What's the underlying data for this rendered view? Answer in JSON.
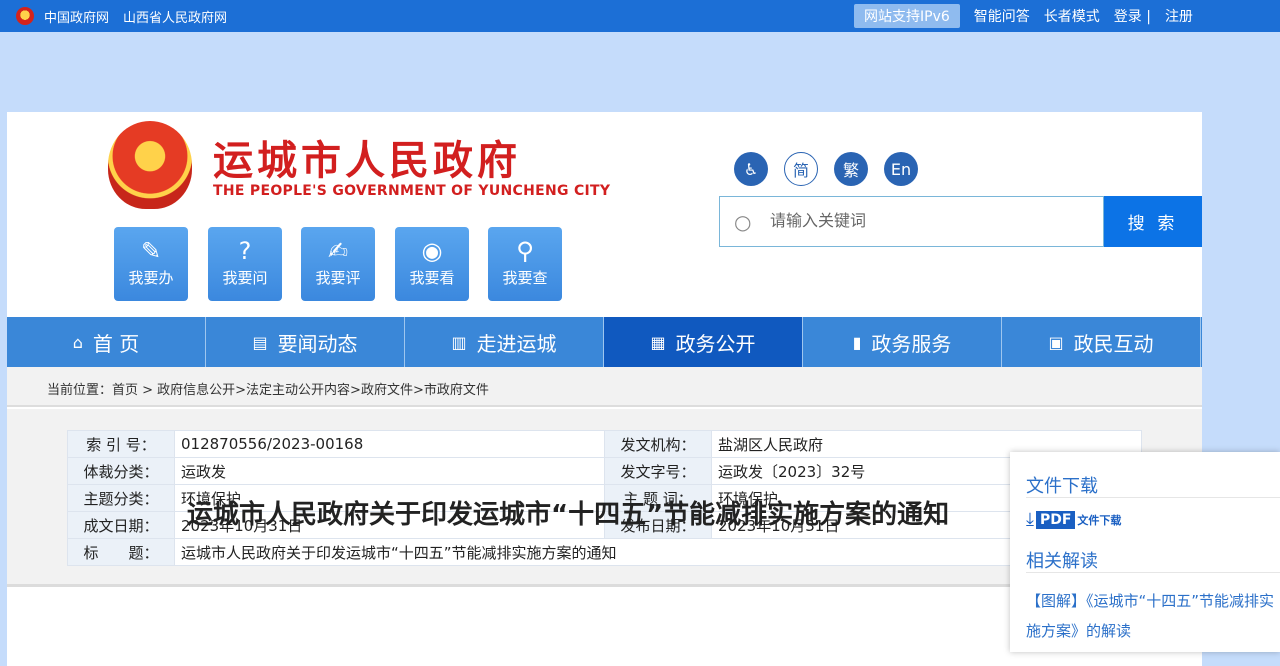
{
  "topbar": {
    "links": [
      "中国政府网",
      "山西省人民政府网"
    ],
    "ipv6": "网站支持IPv6",
    "right_links": [
      "智能问答",
      "长者模式",
      "登录 |",
      "注册"
    ]
  },
  "header": {
    "title": "运城市人民政府",
    "subtitle": "THE PEOPLE'S GOVERNMENT OF YUNCHENG  CITY",
    "quick_links": [
      {
        "label": "我要办",
        "icon": "form-icon"
      },
      {
        "label": "我要问",
        "icon": "question-icon"
      },
      {
        "label": "我要评",
        "icon": "edit-icon"
      },
      {
        "label": "我要看",
        "icon": "eye-icon"
      },
      {
        "label": "我要查",
        "icon": "search-icon"
      }
    ],
    "tools": [
      "accessibility",
      "简",
      "繁",
      "En"
    ],
    "search": {
      "placeholder": "请输入关键词",
      "button": "搜 索"
    }
  },
  "nav": [
    {
      "label": "首 页",
      "icon": "home-icon"
    },
    {
      "label": "要闻动态",
      "icon": "news-icon"
    },
    {
      "label": "走进运城",
      "icon": "building-icon"
    },
    {
      "label": "政务公开",
      "icon": "book-icon",
      "active": true
    },
    {
      "label": "政务服务",
      "icon": "bookmark-icon"
    },
    {
      "label": "政民互动",
      "icon": "chat-icon"
    }
  ],
  "breadcrumb": "当前位置：首页 > 政府信息公开>法定主动公开内容>政府文件>市政府文件",
  "meta": {
    "k1": "索 引 号：",
    "v1": "012870556/2023-00168",
    "k2": "发文机构：",
    "v2": "盐湖区人民政府",
    "k3": "体裁分类：",
    "v3": "运政发",
    "k4": "发文字号：",
    "v4": "运政发〔2023〕32号",
    "k5": "主题分类：",
    "v5": "环境保护",
    "k6": "主 题 词：",
    "v6": "环境保护",
    "k7": "成文日期：",
    "v7": "2023年10月31日",
    "k8": "发布日期：",
    "v8": "2023年10月31日",
    "k9": "标　　题：",
    "v9": "运城市人民政府关于印发运城市“十四五”节能减排实施方案的通知"
  },
  "article_title": "运城市人民政府关于印发运城市“十四五”节能减排实施方案的通知",
  "sidebox": {
    "download_title": "文件下载",
    "pdf_tag": "PDF",
    "pdf_text": "文件下载",
    "related_title": "相关解读",
    "related_link": "【图解】《运城市“十四五”节能减排实施方案》的解读"
  }
}
